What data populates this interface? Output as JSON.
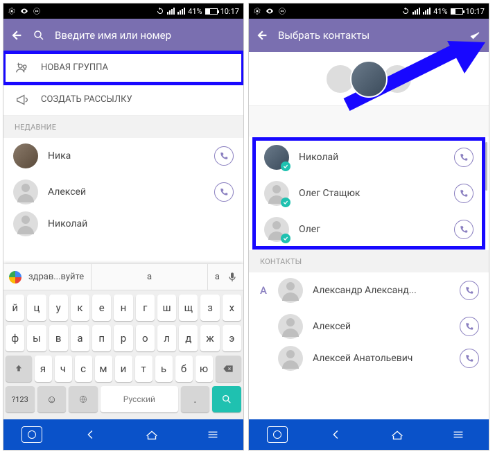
{
  "status": {
    "battery": "41%",
    "time": "10:17"
  },
  "left": {
    "search_placeholder": "Введите имя или номер",
    "new_group": "НОВАЯ ГРУППА",
    "broadcast": "СОЗДАТЬ РАССЫЛКУ",
    "recent_label": "НЕДАВНИЕ",
    "contacts": [
      {
        "name": "Ника"
      },
      {
        "name": "Алексей"
      },
      {
        "name": "Николай"
      }
    ],
    "suggestions": {
      "left": "здрав...вуйте",
      "mid": "а",
      "right": "а"
    },
    "keyboard": {
      "row1": [
        "й",
        "ц",
        "у",
        "к",
        "е",
        "н",
        "г",
        "ш",
        "щ",
        "з",
        "х"
      ],
      "row2": [
        "ф",
        "ы",
        "в",
        "а",
        "п",
        "р",
        "о",
        "л",
        "д",
        "ж",
        "э"
      ],
      "row3": [
        "я",
        "ч",
        "с",
        "м",
        "и",
        "т",
        "ь",
        "б",
        "ю"
      ],
      "numkey": "?123",
      "space": "Русский"
    }
  },
  "right": {
    "title": "Выбрать контакты",
    "search_hint_hidden": "",
    "selected": [
      {
        "name": "Николай"
      },
      {
        "name": "Олег Стащюк"
      },
      {
        "name": "Олег"
      }
    ],
    "contacts_label": "КОНТАКТЫ",
    "alpha": "А",
    "alpha_contacts": [
      {
        "name": "Александр Александ..."
      },
      {
        "name": "Алексей"
      },
      {
        "name": "Алексей Анатольевич"
      }
    ]
  }
}
